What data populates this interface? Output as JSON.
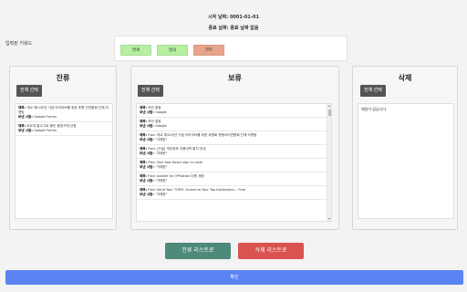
{
  "header": {
    "start_date": "시작 날짜: 0001-01-01",
    "end_date": "종료 날짜: 종료 날짜 없음"
  },
  "keywords": {
    "label": "입력된 키워드",
    "chips": [
      {
        "label": "면세",
        "color": "#b6f0a0"
      },
      {
        "label": "정의",
        "color": "#b6f0a0"
      },
      {
        "label": "코트",
        "color": "#e8a48c"
      }
    ]
  },
  "panels": {
    "keep": {
      "title": "잔류",
      "select_all": "전체 선택",
      "items": [
        {
          "title_label": "제목:",
          "title": "개교 제10주년 기념 아카이브를 위한 후원 인연합회 단체 티켓팅",
          "sender_label": "보낸 사람:",
          "sender": "Google Forms"
        },
        {
          "title_label": "제목:",
          "title": "모르게 발수기로 할인 증정구매 신청",
          "sender_label": "보낸 사람:",
          "sender": "Google Forms"
        }
      ]
    },
    "hold": {
      "title": "보류",
      "select_all": "전체 선택",
      "items": [
        {
          "title_label": "제목:",
          "title": "보안 알림",
          "sender_label": "보낸 사람:",
          "sender": "Google"
        },
        {
          "title_label": "제목:",
          "title": "보안 알림",
          "sender_label": "보낸 사람:",
          "sender": "Google"
        },
        {
          "title_label": "제목:",
          "title": "Fwd: 개교 제10주년 기념 아카이브를 위한 후원회 총동아리연합회 단체 티켓팅",
          "sender_label": "보낸 사람:",
          "sender": "\"가례한\""
        },
        {
          "title_label": "제목:",
          "title": "Fwd: [구글] 개인정보 이용내역 통지 안내",
          "sender_label": "보낸 사람:",
          "sender": "\"가례한\""
        },
        {
          "title_label": "제목:",
          "title": "Fwd: Your two-factor sign in code",
          "sender_label": "보낸 사람:",
          "sender": "\"가례한\""
        },
        {
          "title_label": "제목:",
          "title": "Fwd: bubble for JYPnation 이용 계정",
          "sender_label": "보낸 사람:",
          "sender": "\"가례한\""
        },
        {
          "title_label": "제목:",
          "title": "Fwd: Send Your TOEFL Scores to Your Top Institutions – Free",
          "sender_label": "보낸 사람:",
          "sender": "\"가례한\""
        }
      ]
    },
    "del": {
      "title": "삭제",
      "select_all": "전체 선택",
      "empty_text": "메일이 없습니다."
    }
  },
  "actions": {
    "to_keep": "잔류 리스트로",
    "to_delete": "삭제 리스트로",
    "confirm": "확인"
  }
}
